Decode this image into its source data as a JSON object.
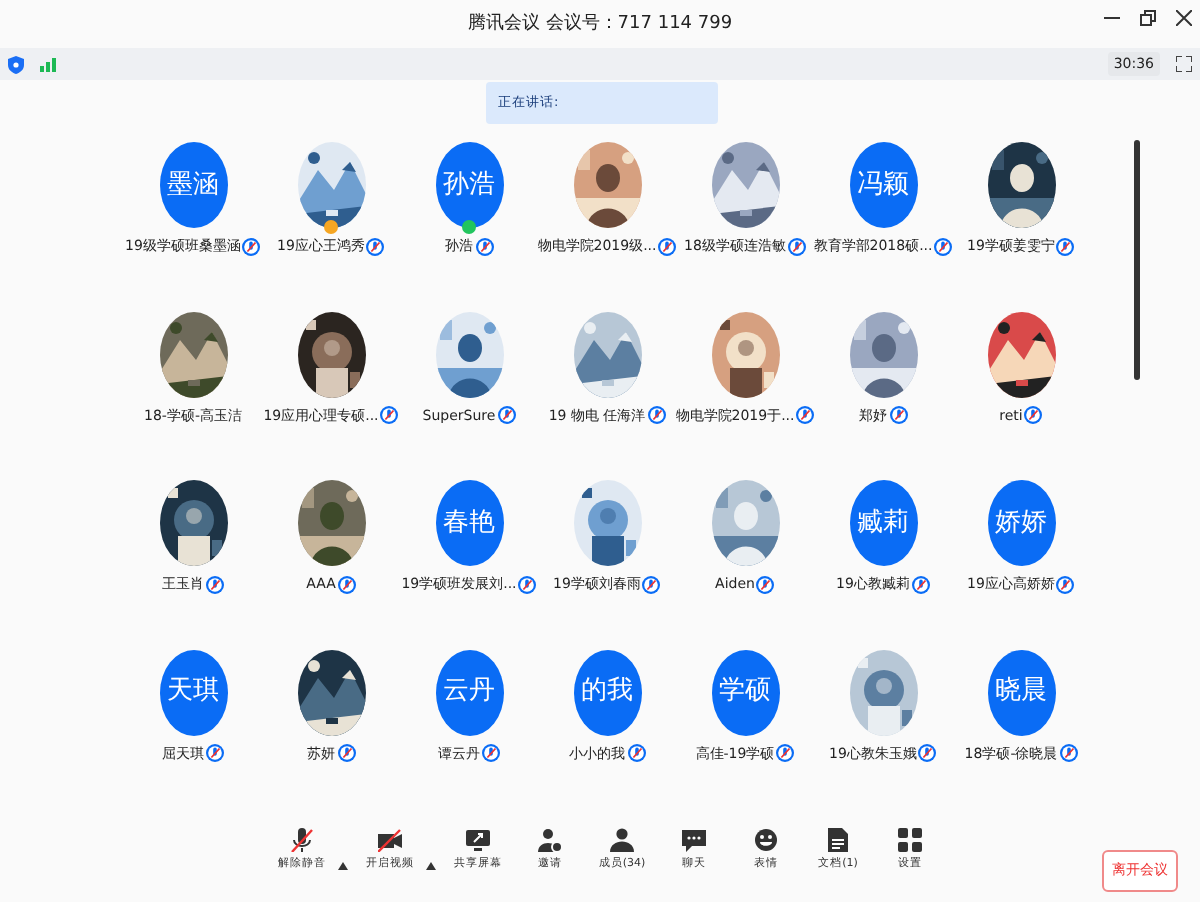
{
  "window": {
    "title": "腾讯会议 会议号：717 114 799"
  },
  "status_bar": {
    "timer": "30:36"
  },
  "speaking": {
    "label": "正在讲话:"
  },
  "participants": [
    {
      "kind": "initials",
      "initials": "墨涵",
      "name": "19级学硕班桑墨涵",
      "muted": true
    },
    {
      "kind": "picture",
      "name": "19应心王鸿秀",
      "muted": true,
      "color": "#f5a623"
    },
    {
      "kind": "initials",
      "initials": "孙浩",
      "name": "孙浩",
      "muted": true,
      "color": "#22c55e"
    },
    {
      "kind": "picture",
      "name": "物电学院2019级...",
      "muted": true
    },
    {
      "kind": "picture",
      "name": "18级学硕连浩敏",
      "muted": true
    },
    {
      "kind": "initials",
      "initials": "冯颖",
      "name": "教育学部2018硕...",
      "muted": true
    },
    {
      "kind": "picture",
      "name": "19学硕姜雯宁",
      "muted": true
    },
    {
      "kind": "picture",
      "name": "18-学硕-高玉洁",
      "muted": false
    },
    {
      "kind": "picture",
      "name": "19应用心理专硕...",
      "muted": true
    },
    {
      "kind": "picture",
      "name": "SuperSure",
      "muted": true
    },
    {
      "kind": "picture",
      "name": "19 物电 任海洋",
      "muted": true
    },
    {
      "kind": "picture",
      "name": "物电学院2019于...",
      "muted": true
    },
    {
      "kind": "picture",
      "name": "郑妤",
      "muted": true
    },
    {
      "kind": "picture",
      "name": "reti",
      "muted": true
    },
    {
      "kind": "picture",
      "name": "王玉肖",
      "muted": true
    },
    {
      "kind": "picture",
      "name": "AAA",
      "muted": true
    },
    {
      "kind": "initials",
      "initials": "春艳",
      "name": "19学硕班发展刘...",
      "muted": true
    },
    {
      "kind": "picture",
      "name": "19学硕刘春雨",
      "muted": true
    },
    {
      "kind": "picture",
      "name": "Aiden",
      "muted": true
    },
    {
      "kind": "initials",
      "initials": "臧莉",
      "name": "19心教臧莉",
      "muted": true
    },
    {
      "kind": "initials",
      "initials": "娇娇",
      "name": "19应心高娇娇",
      "muted": true
    },
    {
      "kind": "initials",
      "initials": "天琪",
      "name": "屈天琪",
      "muted": true
    },
    {
      "kind": "picture",
      "name": "苏妍",
      "muted": true
    },
    {
      "kind": "initials",
      "initials": "云丹",
      "name": "谭云丹",
      "muted": true
    },
    {
      "kind": "initials",
      "initials": "的我",
      "name": "小小的我",
      "muted": true
    },
    {
      "kind": "initials",
      "initials": "学硕",
      "name": "高佳-19学硕",
      "muted": true
    },
    {
      "kind": "picture",
      "name": "19心教朱玉娥",
      "muted": true
    },
    {
      "kind": "initials",
      "initials": "晓晨",
      "name": "18学硕-徐晓晨",
      "muted": true
    }
  ],
  "toolbar": [
    {
      "kind": "mic-off",
      "label": "解除静音",
      "menu": true
    },
    {
      "kind": "camera-off",
      "label": "开启视频",
      "menu": true
    },
    {
      "kind": "share",
      "label": "共享屏幕",
      "menu": false
    },
    {
      "kind": "invite",
      "label": "邀请",
      "menu": false
    },
    {
      "kind": "members",
      "label": "成员(34)",
      "menu": false
    },
    {
      "kind": "chat",
      "label": "聊天",
      "menu": false
    },
    {
      "kind": "emoji",
      "label": "表情",
      "menu": false
    },
    {
      "kind": "document",
      "label": "文档(1)",
      "menu": false
    },
    {
      "kind": "settings",
      "label": "设置",
      "menu": false
    }
  ],
  "leave_button": "离开会议"
}
